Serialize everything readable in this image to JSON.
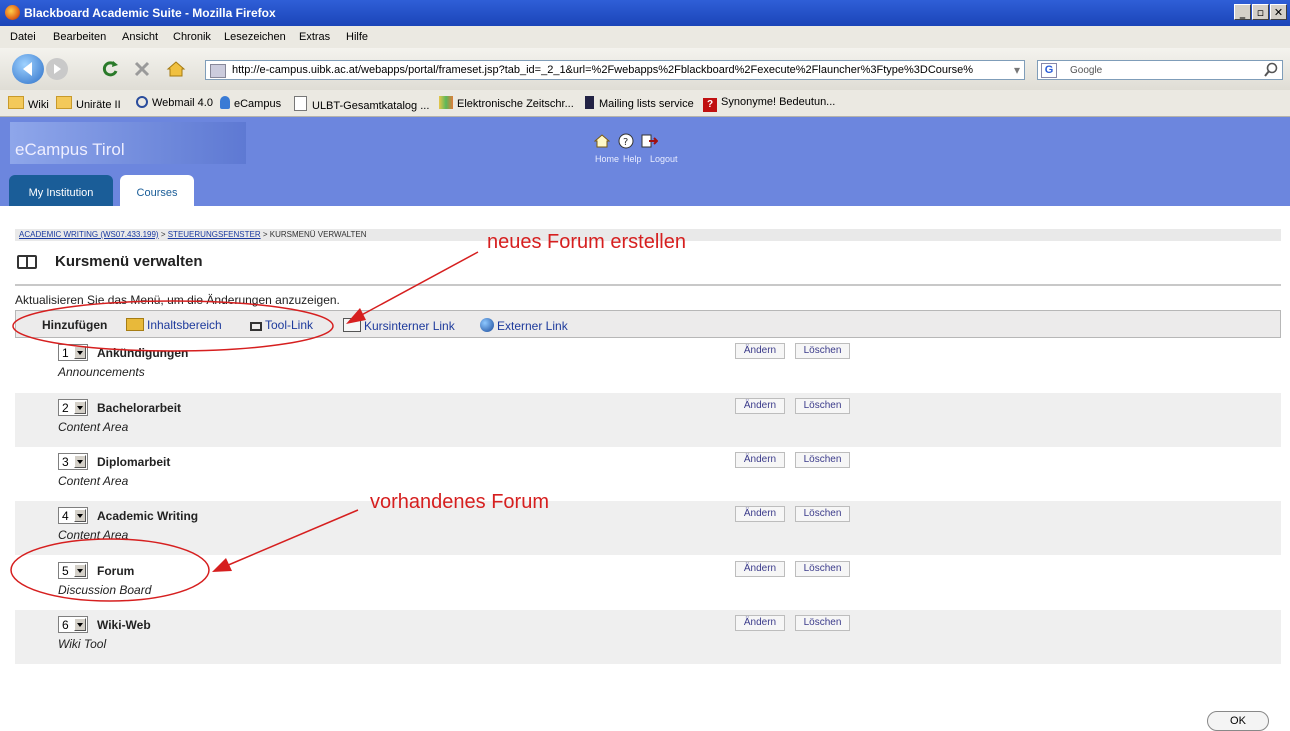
{
  "window": {
    "title": "Blackboard Academic Suite - Mozilla Firefox",
    "controls": [
      "_",
      "▫",
      "✕"
    ]
  },
  "menubar": [
    "Datei",
    "Bearbeiten",
    "Ansicht",
    "Chronik",
    "Lesezeichen",
    "Extras",
    "Hilfe"
  ],
  "navbar": {
    "url": "http://e-campus.uibk.ac.at/webapps/portal/frameset.jsp?tab_id=_2_1&url=%2Fwebapps%2Fblackboard%2Fexecute%2Flauncher%3Ftype%3DCourse%",
    "search_placeholder": "Google"
  },
  "bookmarks": [
    "Wiki",
    "Uniräte II",
    "Webmail 4.0",
    "eCampus",
    "ULBT-Gesamtkatalog ...",
    "Elektronische Zeitschr...",
    "Mailing lists service",
    "Synonyme! Bedeutun..."
  ],
  "bb": {
    "logo": "eCampus Tirol",
    "header_links": [
      "Home",
      "Help",
      "Logout"
    ],
    "tabs": [
      "My Institution",
      "Courses"
    ]
  },
  "breadcrumb": {
    "part1": "ACADEMIC WRITING (WS07.433.199)",
    "sep": " > ",
    "part2": "STEUERUNGSFENSTER",
    "part3": "KURSMENÜ VERWALTEN"
  },
  "page": {
    "title": "Kursmenü verwalten",
    "info": "Aktualisieren Sie das Menü, um die Änderungen anzuzeigen."
  },
  "addbar": {
    "label": "Hinzufügen",
    "items": [
      "Inhaltsbereich",
      "Tool-Link",
      "Kursinterner Link",
      "Externer Link"
    ]
  },
  "rows": [
    {
      "num": "1",
      "name": "Ankündigungen",
      "type": "Announcements"
    },
    {
      "num": "2",
      "name": "Bachelorarbeit",
      "type": "Content Area"
    },
    {
      "num": "3",
      "name": "Diplomarbeit",
      "type": "Content Area"
    },
    {
      "num": "4",
      "name": "Academic Writing",
      "type": "Content Area"
    },
    {
      "num": "5",
      "name": "Forum",
      "type": "Discussion Board"
    },
    {
      "num": "6",
      "name": "Wiki-Web",
      "type": "Wiki Tool"
    }
  ],
  "row_buttons": {
    "edit": "Ändern",
    "delete": "Löschen"
  },
  "annotations": {
    "new_forum": "neues Forum erstellen",
    "existing_forum": "vorhandenes Forum",
    "color": "#d61f1f"
  },
  "ok_button": "OK"
}
